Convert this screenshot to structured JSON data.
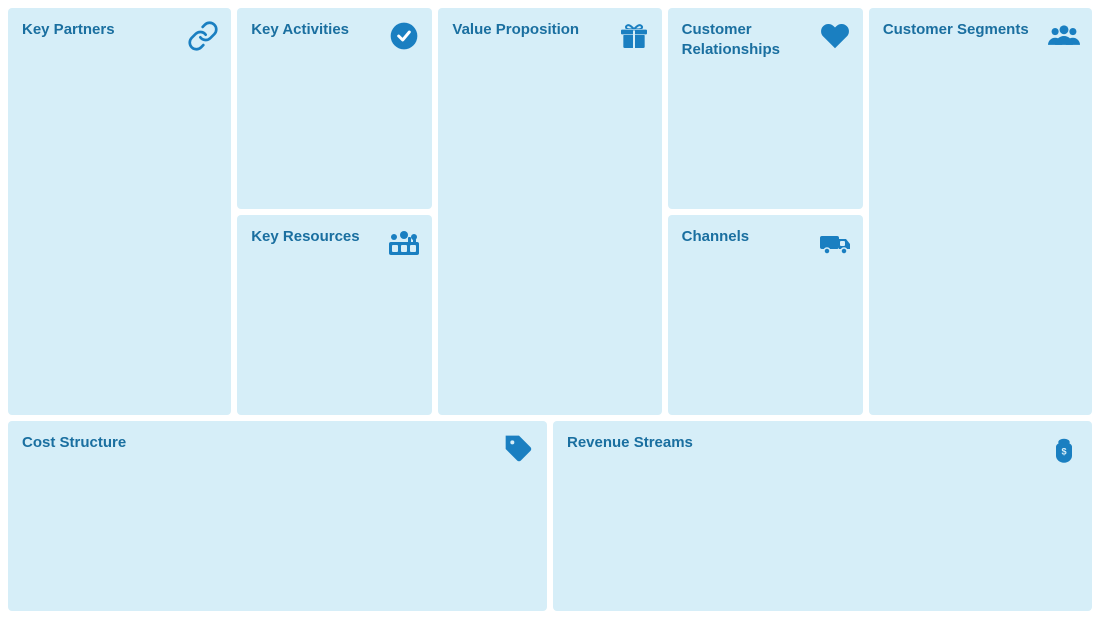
{
  "cells": {
    "key_partners": {
      "title": "Key Partners",
      "icon": "link"
    },
    "key_activities": {
      "title": "Key Activities",
      "icon": "check"
    },
    "key_resources": {
      "title": "Key Resources",
      "icon": "factory"
    },
    "value_proposition": {
      "title": "Value Proposition",
      "icon": "gift"
    },
    "customer_relationships": {
      "title": "Customer Relationships",
      "icon": "heart"
    },
    "channels": {
      "title": "Channels",
      "icon": "truck"
    },
    "customer_segments": {
      "title": "Customer Segments",
      "icon": "people"
    },
    "cost_structure": {
      "title": "Cost Structure",
      "icon": "tag"
    },
    "revenue_streams": {
      "title": "Revenue Streams",
      "icon": "moneybag"
    }
  }
}
